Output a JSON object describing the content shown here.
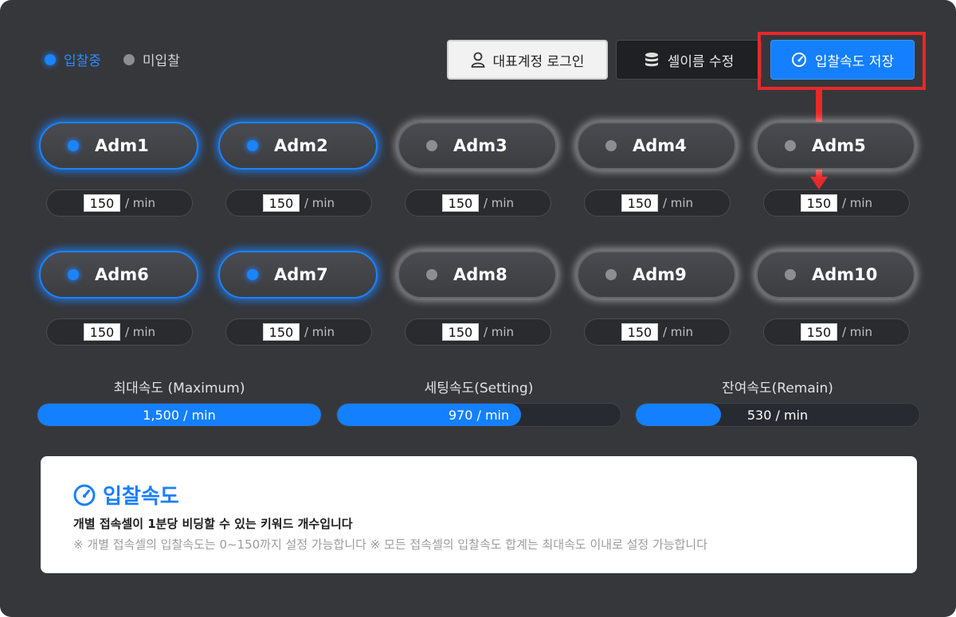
{
  "legend": {
    "active_label": "입찰중",
    "inactive_label": "미입찰"
  },
  "toolbar": {
    "login_label": "대표계정 로그인",
    "login_icon": "user-icon",
    "rename_label": "셀이름 수정",
    "rename_icon": "database-icon",
    "save_label": "입찰속도 저장",
    "save_icon": "gauge-icon"
  },
  "cells": [
    {
      "name": "Adm1",
      "active": true,
      "speed": "150",
      "unit": "/ min"
    },
    {
      "name": "Adm2",
      "active": true,
      "speed": "150",
      "unit": "/ min"
    },
    {
      "name": "Adm3",
      "active": false,
      "speed": "150",
      "unit": "/ min"
    },
    {
      "name": "Adm4",
      "active": false,
      "speed": "150",
      "unit": "/ min"
    },
    {
      "name": "Adm5",
      "active": false,
      "speed": "150",
      "unit": "/ min"
    },
    {
      "name": "Adm6",
      "active": true,
      "speed": "150",
      "unit": "/ min"
    },
    {
      "name": "Adm7",
      "active": true,
      "speed": "150",
      "unit": "/ min"
    },
    {
      "name": "Adm8",
      "active": false,
      "speed": "150",
      "unit": "/ min"
    },
    {
      "name": "Adm9",
      "active": false,
      "speed": "150",
      "unit": "/ min"
    },
    {
      "name": "Adm10",
      "active": false,
      "speed": "150",
      "unit": "/ min"
    }
  ],
  "stats": [
    {
      "label": "최대속도 (Maximum)",
      "value_text": "1,500 / min",
      "fill_fraction": 1.0
    },
    {
      "label": "세팅속도(Setting)",
      "value_text": "970 / min",
      "fill_fraction": 0.65
    },
    {
      "label": "잔여속도(Remain)",
      "value_text": "530 / min",
      "fill_fraction": 0.3
    }
  ],
  "info": {
    "title": "입찰속도",
    "title_icon": "gauge-icon",
    "line1": "개별 접속셀이 1분당 비딩할 수 있는 키워드 개수입니다",
    "line2": "※ 개별 접속셀의 입찰속도는 0~150까지 설정 가능합니다  ※ 모든 접속셀의 입찰속도 합계는 최대속도 이내로 설정 가능합니다"
  },
  "colors": {
    "accent": "#1480ff",
    "panel_bg": "#36373b",
    "highlight": "#e8282a"
  }
}
